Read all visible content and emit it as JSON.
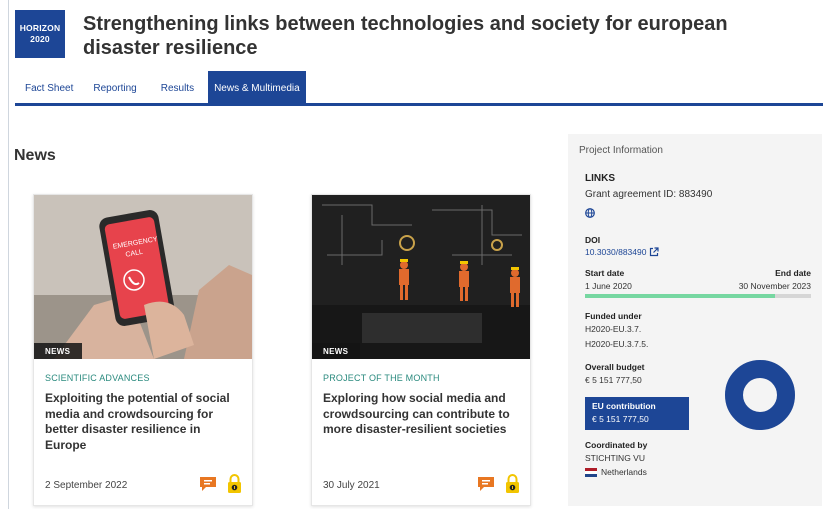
{
  "header": {
    "logo_line1": "HORIZON",
    "logo_line2": "2020",
    "title": "Strengthening links between technologies and society for european disaster resilience"
  },
  "tabs": [
    {
      "label": "Fact Sheet",
      "active": false
    },
    {
      "label": "Reporting",
      "active": false
    },
    {
      "label": "Results",
      "active": false
    },
    {
      "label": "News & Multimedia",
      "active": true
    }
  ],
  "news": {
    "heading": "News",
    "cards": [
      {
        "badge": "NEWS",
        "category": "SCIENTIFIC ADVANCES",
        "title": "Exploiting the potential of social media and crowdsourcing for better disaster resilience in Europe",
        "date": "2 September 2022",
        "image_text_1": "EMERGENCY",
        "image_text_2": "CALL"
      },
      {
        "badge": "NEWS",
        "category": "PROJECT OF THE MONTH",
        "title": "Exploring how social media and crowdsourcing can contribute to more disaster-resilient societies",
        "date": "30 July 2021"
      }
    ]
  },
  "project_info": {
    "heading": "Project Information",
    "links_label": "LINKS",
    "grant": "Grant agreement ID: 883490",
    "doi_label": "DOI",
    "doi": "10.3030/883490",
    "start_label": "Start date",
    "end_label": "End date",
    "start_date": "1 June 2020",
    "end_date": "30 November 2023",
    "progress_fraction": 0.84,
    "funded_label": "Funded under",
    "funded_1": "H2020-EU.3.7.",
    "funded_2": "H2020-EU.3.7.5.",
    "budget_label": "Overall budget",
    "budget": "€ 5 151 777,50",
    "eu_label": "EU contribution",
    "eu_value": "€ 5 151 777,50",
    "eu_share_fraction": 1.0,
    "coord_label": "Coordinated by",
    "coordinator": "STICHTING VU",
    "country": "Netherlands"
  },
  "colors": {
    "brand_blue": "#1d4696",
    "category_teal": "#2a8a7e",
    "progress_green": "#76d7a1",
    "comment_orange": "#e87722",
    "lock_yellow": "#f2c500"
  },
  "icons": [
    "globe-icon",
    "external-link-icon",
    "comment-icon",
    "lock-icon",
    "netherlands-flag-icon"
  ]
}
